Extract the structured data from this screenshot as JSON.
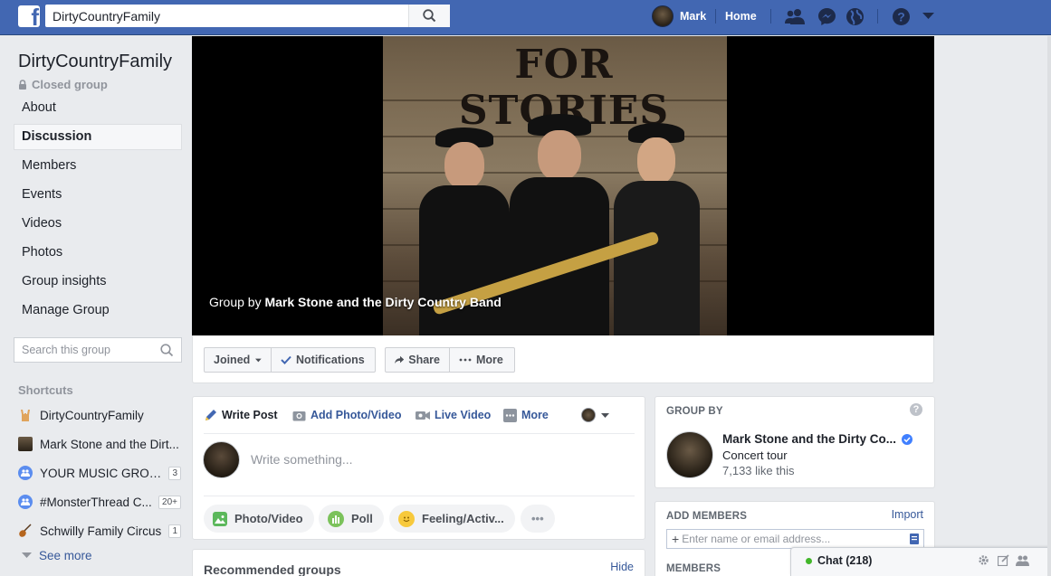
{
  "topbar": {
    "search_value": "DirtyCountryFamily",
    "user_name": "Mark",
    "home_label": "Home",
    "icons": [
      "friends-icon",
      "messenger-icon",
      "notifications-globe-icon",
      "help-icon",
      "chevron-down-icon"
    ]
  },
  "sidebar": {
    "group_name": "DirtyCountryFamily",
    "privacy": "Closed group",
    "nav": [
      {
        "label": "About"
      },
      {
        "label": "Discussion"
      },
      {
        "label": "Members"
      },
      {
        "label": "Events"
      },
      {
        "label": "Videos"
      },
      {
        "label": "Photos"
      },
      {
        "label": "Group insights"
      },
      {
        "label": "Manage Group"
      }
    ],
    "search_placeholder": "Search this group",
    "shortcuts_title": "Shortcuts",
    "shortcuts": [
      {
        "label": "DirtyCountryFamily",
        "badge": ""
      },
      {
        "label": "Mark Stone and the Dirt...",
        "badge": ""
      },
      {
        "label": "YOUR MUSIC GROU...",
        "badge": "3"
      },
      {
        "label": "#MonsterThread C...",
        "badge": "20+"
      },
      {
        "label": "Schwilly Family Circus",
        "badge": "1"
      }
    ],
    "see_more": "See more"
  },
  "cover": {
    "banner_text": "FOR STORIES",
    "caption_prefix": "Group by",
    "caption_name": "Mark Stone and the Dirty Country Band"
  },
  "actions": {
    "joined": "Joined",
    "notifications": "Notifications",
    "share": "Share",
    "more": "More"
  },
  "composer": {
    "tabs": {
      "write": "Write Post",
      "photo": "Add Photo/Video",
      "live": "Live Video",
      "more": "More"
    },
    "placeholder": "Write something...",
    "pills": {
      "photo": "Photo/Video",
      "poll": "Poll",
      "feeling": "Feeling/Activ...",
      "dots": "•••"
    }
  },
  "recommended": {
    "title": "Recommended groups",
    "hide": "Hide"
  },
  "group_by": {
    "title": "GROUP BY",
    "name": "Mark Stone and the Dirty Co...",
    "category": "Concert tour",
    "likes": "7,133 like this"
  },
  "add_members": {
    "title": "ADD MEMBERS",
    "import": "Import",
    "placeholder": "Enter name or email address...",
    "members_title": "MEMBERS"
  },
  "chat": {
    "label": "Chat (218)"
  },
  "colors": {
    "brand": "#4267b2",
    "link": "#365899",
    "online": "#42b72a",
    "page_bg": "#e9ebee"
  }
}
